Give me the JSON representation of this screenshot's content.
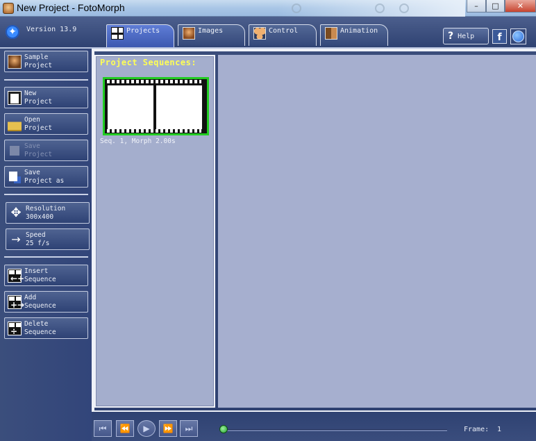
{
  "window": {
    "title": "New Project - FotoMorph",
    "controls": {
      "minimize": "–",
      "maximize": "□",
      "close": "✕"
    }
  },
  "header": {
    "version": "Version 13.9",
    "tabs": [
      {
        "label": "Projects",
        "icon": "projects-grid-icon",
        "active": true
      },
      {
        "label": "Images",
        "icon": "images-face-icon",
        "active": false
      },
      {
        "label": "Control",
        "icon": "control-faces-icon",
        "active": false
      },
      {
        "label": "Animation",
        "icon": "animation-icon",
        "active": false
      }
    ],
    "help_label": "Help",
    "facebook_label": "f"
  },
  "sidebar": {
    "items": [
      {
        "line1": "Sample",
        "line2": "Project",
        "icon": "sample-face-icon",
        "disabled": false
      },
      {
        "line1": "New",
        "line2": "Project",
        "icon": "new-project-icon",
        "disabled": false
      },
      {
        "line1": "Open",
        "line2": "Project",
        "icon": "open-folder-icon",
        "disabled": false
      },
      {
        "line1": "Save",
        "line2": "Project",
        "icon": "save-disk-icon",
        "disabled": true
      },
      {
        "line1": "Save",
        "line2": "Project as",
        "icon": "save-as-icon",
        "disabled": false
      },
      {
        "line1": "Resolution",
        "line2": "300x400",
        "icon": "move-arrows-icon",
        "disabled": false
      },
      {
        "line1": "Speed",
        "line2": "25 f/s",
        "icon": "runner-icon",
        "disabled": false
      },
      {
        "line1": "Insert",
        "line2": "Sequence",
        "icon": "insert-sequence-icon",
        "disabled": false
      },
      {
        "line1": "Add",
        "line2": "Sequence",
        "icon": "add-sequence-icon",
        "disabled": false
      },
      {
        "line1": "Delete",
        "line2": "Sequence",
        "icon": "delete-sequence-icon",
        "disabled": false
      }
    ]
  },
  "panel": {
    "title": "Project Sequences:",
    "sequences": [
      {
        "label": "Seq. 1,  Morph 2.00s"
      }
    ]
  },
  "playback": {
    "buttons": [
      {
        "name": "first-frame",
        "glyph": "⏮"
      },
      {
        "name": "prev-frame",
        "glyph": "⏪"
      },
      {
        "name": "play",
        "glyph": "▶"
      },
      {
        "name": "next-frame",
        "glyph": "⏩"
      },
      {
        "name": "last-frame",
        "glyph": "⏭"
      }
    ],
    "position_fraction": 0.0,
    "frame_label": "Frame:",
    "frame_value": "1"
  },
  "colors": {
    "accent_yellow": "#ffff55",
    "selected_border": "#22cc22",
    "panel_bg": "#a4aecd"
  }
}
